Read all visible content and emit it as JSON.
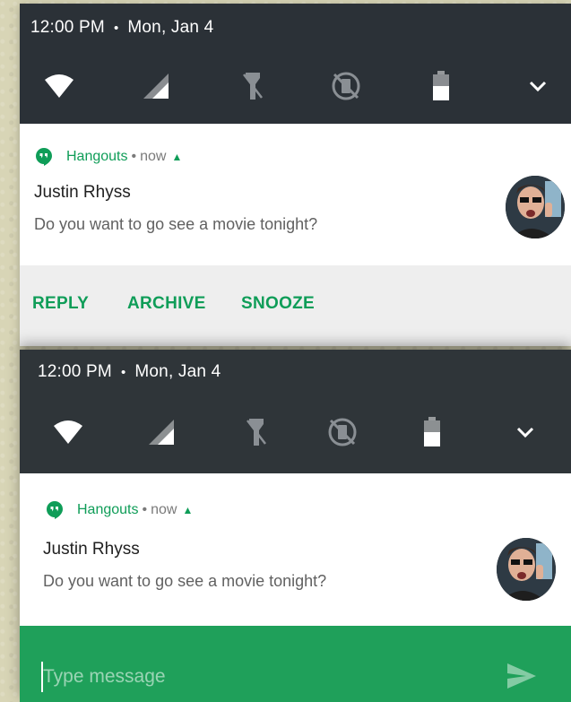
{
  "status_bar": {
    "time": "12:00 PM",
    "separator": "•",
    "date": "Mon, Jan 4"
  },
  "quick_settings": [
    {
      "name": "wifi-icon"
    },
    {
      "name": "cellular-signal-icon"
    },
    {
      "name": "flashlight-off-icon"
    },
    {
      "name": "auto-rotate-off-icon"
    },
    {
      "name": "battery-icon"
    },
    {
      "name": "expand-chevron-icon"
    }
  ],
  "notification": {
    "app_name": "Hangouts",
    "separator": "•",
    "time": "now",
    "expand_caret": "^",
    "sender": "Justin Rhyss",
    "message": "Do you want to go see a movie tonight?"
  },
  "actions": {
    "reply": "REPLY",
    "archive": "ARCHIVE",
    "snooze": "SNOOZE"
  },
  "reply_bar": {
    "placeholder": "Type message"
  },
  "colors": {
    "accent": "#0f9d58",
    "shade": "#2b3137",
    "reply_bar": "#1fa05a"
  }
}
